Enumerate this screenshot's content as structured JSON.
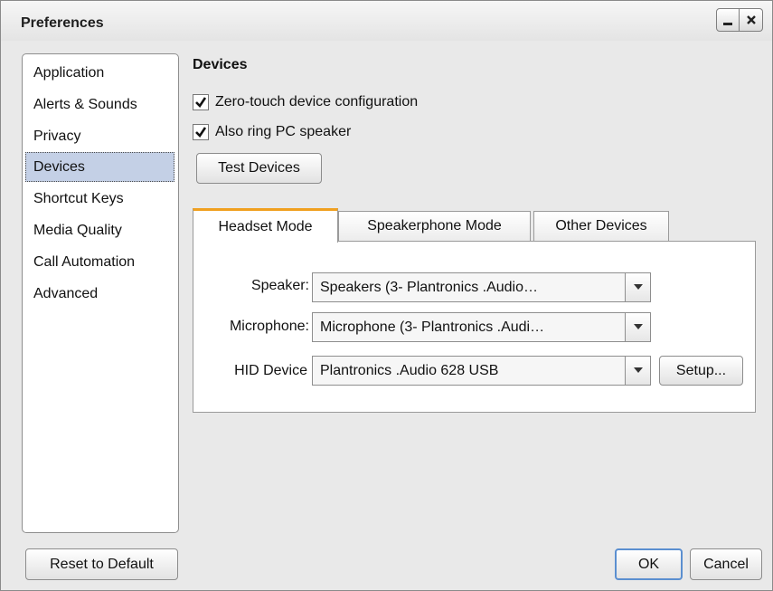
{
  "window": {
    "title": "Preferences"
  },
  "sidebar": {
    "items": [
      {
        "label": "Application"
      },
      {
        "label": "Alerts & Sounds"
      },
      {
        "label": "Privacy"
      },
      {
        "label": "Devices",
        "selected": true
      },
      {
        "label": "Shortcut Keys"
      },
      {
        "label": "Media Quality"
      },
      {
        "label": "Call Automation"
      },
      {
        "label": "Advanced"
      }
    ]
  },
  "devices": {
    "title": "Devices",
    "zero_touch": {
      "label": "Zero-touch device configuration",
      "checked": true
    },
    "ring_pc": {
      "label": "Also ring PC speaker",
      "checked": true
    },
    "test_button": "Test Devices"
  },
  "tabs": [
    {
      "label": "Headset Mode",
      "active": true
    },
    {
      "label": "Speakerphone Mode"
    },
    {
      "label": "Other Devices"
    }
  ],
  "headset": {
    "speaker_label": "Speaker:",
    "speaker_value": "Speakers (3- Plantronics .Audio…",
    "microphone_label": "Microphone:",
    "microphone_value": "Microphone (3- Plantronics .Audi…",
    "hid_label": "HID Device",
    "hid_value": "Plantronics .Audio 628 USB",
    "setup_button": "Setup..."
  },
  "footer": {
    "reset": "Reset to Default",
    "ok": "OK",
    "cancel": "Cancel"
  },
  "colors": {
    "accent": "#f0a020",
    "selection": "#c4d0e6",
    "ok_border": "#5b8fd0"
  }
}
